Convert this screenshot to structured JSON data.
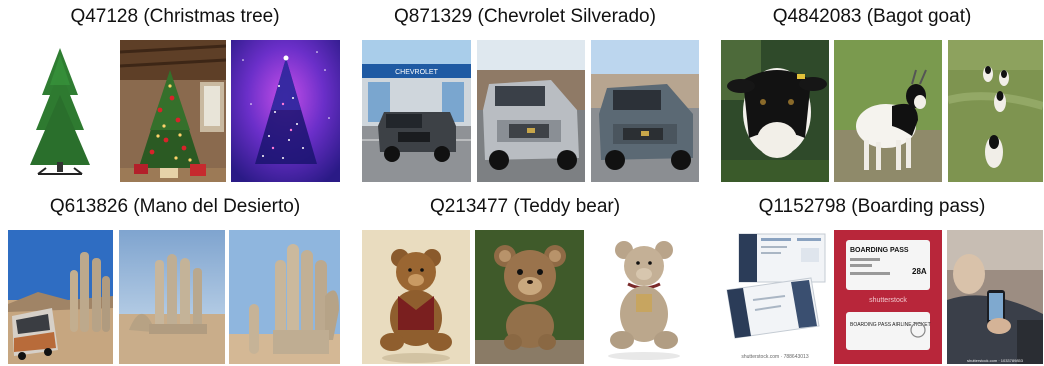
{
  "grid": [
    {
      "caption": "Q47128 (Christmas tree)"
    },
    {
      "caption": "Q871329 (Chevrolet Silverado)"
    },
    {
      "caption": "Q4842083 (Bagot goat)"
    },
    {
      "caption": "Q613826 (Mano del Desierto)"
    },
    {
      "caption": "Q213477 (Teddy bear)"
    },
    {
      "caption": "Q1152798 (Boarding pass)"
    }
  ],
  "images": {
    "silverado_sign": "CHEVROLET",
    "shutterstock_watermark": "shutterstock",
    "boarding_pass_header": "BOARDING PASS",
    "boarding_pass_seat": "28A",
    "boarding_pass_airline_ticket": "BOARDING PASS AIRLINE TICKET",
    "stock_footer_1": "shutterstock.com · 788643013",
    "stock_footer_2": "shutterstock.com · 1033789853"
  }
}
